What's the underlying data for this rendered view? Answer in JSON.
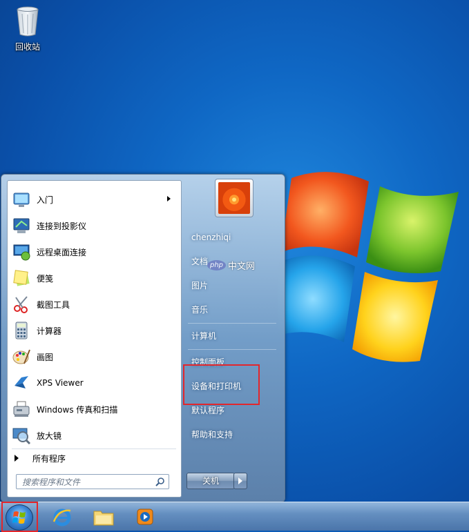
{
  "desktop": {
    "recycle_bin_label": "回收站"
  },
  "start_menu": {
    "programs": [
      {
        "label": "入门",
        "icon": "getting-started-icon",
        "has_submenu": true
      },
      {
        "label": "连接到投影仪",
        "icon": "projector-icon"
      },
      {
        "label": "远程桌面连接",
        "icon": "remote-desktop-icon"
      },
      {
        "label": "便笺",
        "icon": "sticky-notes-icon"
      },
      {
        "label": "截图工具",
        "icon": "snipping-tool-icon"
      },
      {
        "label": "计算器",
        "icon": "calculator-icon"
      },
      {
        "label": "画图",
        "icon": "paint-icon"
      },
      {
        "label": "XPS Viewer",
        "icon": "xps-viewer-icon"
      },
      {
        "label": "Windows 传真和扫描",
        "icon": "fax-scan-icon"
      },
      {
        "label": "放大镜",
        "icon": "magnifier-icon"
      }
    ],
    "all_programs_label": "所有程序",
    "search_placeholder": "搜索程序和文件",
    "right": {
      "user_name": "chenzhiqi",
      "documents": "文档",
      "pictures": "图片",
      "music": "音乐",
      "computer": "计算机",
      "control_panel": "控制面板",
      "devices_printers": "设备和打印机",
      "default_programs": "默认程序",
      "help_support": "帮助和支持"
    },
    "shutdown_label": "关机"
  },
  "watermark": {
    "php": "php",
    "text": "中文网"
  },
  "taskbar": {
    "items": [
      "start-orb-icon",
      "internet-explorer-icon",
      "file-explorer-icon",
      "media-player-icon"
    ]
  },
  "colors": {
    "highlight_box": "#e3262b"
  }
}
